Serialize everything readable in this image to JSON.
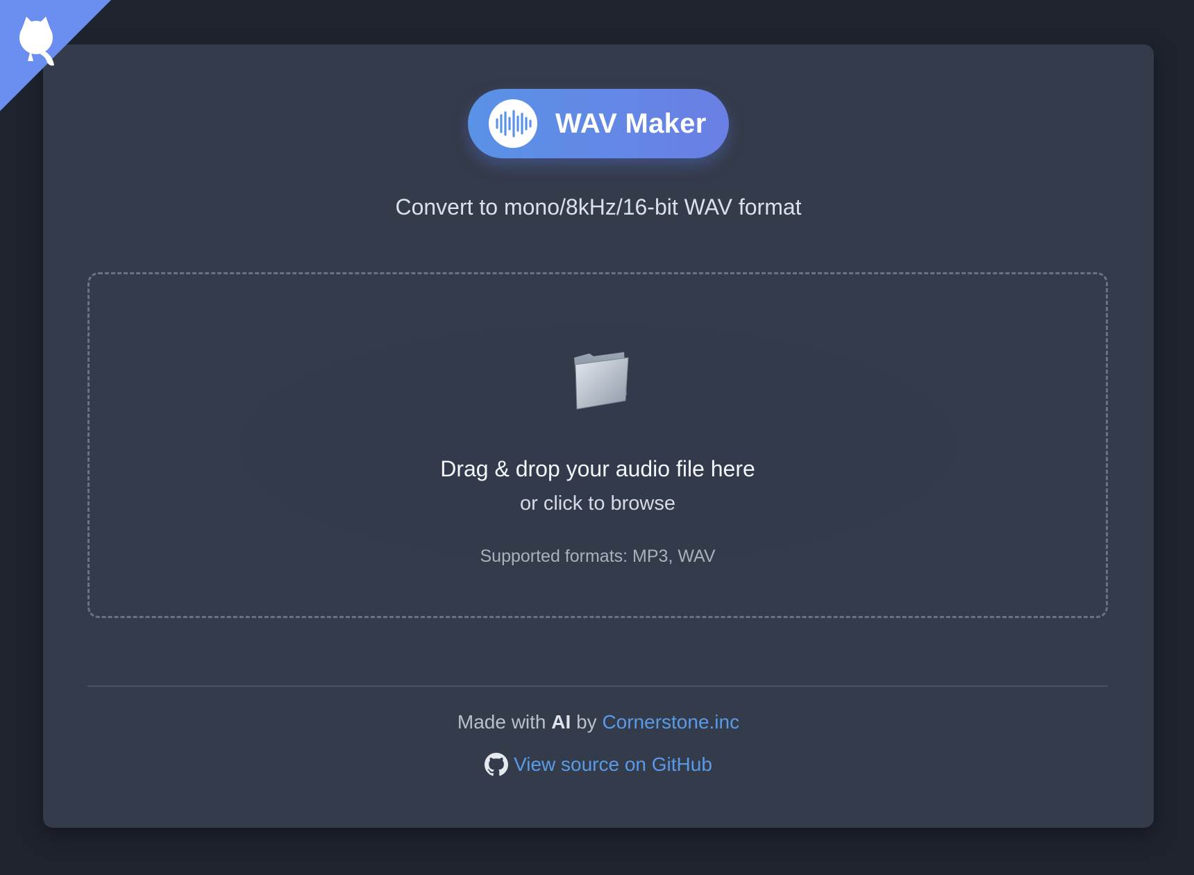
{
  "brand": {
    "title": "WAV Maker",
    "icon": "waveform-icon",
    "gradient": [
      "#5a92e6",
      "#6a7fe4"
    ]
  },
  "subtitle": "Convert to mono/8kHz/16-bit WAV format",
  "dropzone": {
    "icon": "folder-icon",
    "title": "Drag & drop your audio file here",
    "subtitle": "or click to browse",
    "formats": "Supported formats: MP3, WAV"
  },
  "footer": {
    "made_with": "Made with",
    "ai": "AI",
    "by": "by",
    "company": "Cornerstone.inc",
    "github_link": "View source on GitHub",
    "github_icon": "github-icon"
  },
  "corner": {
    "icon": "github-octocat-icon",
    "color": "#6b8ff0"
  },
  "colors": {
    "background": "#1f232e",
    "card": "#343b4a",
    "link": "#5a9be8"
  }
}
